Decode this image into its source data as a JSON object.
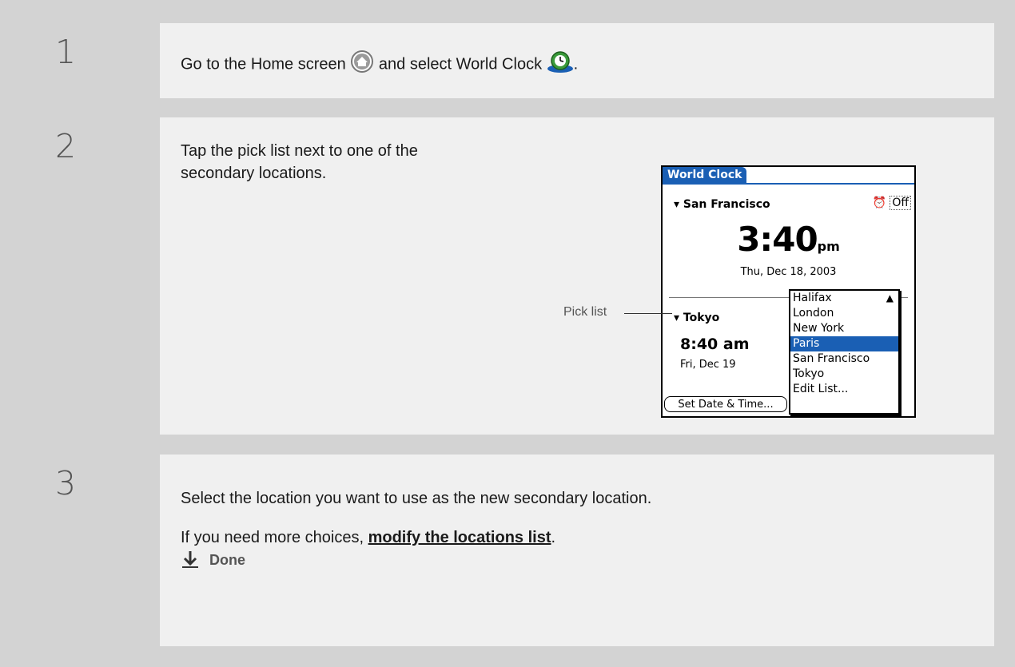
{
  "steps": [
    {
      "number": "1",
      "text_before_home": "Go to the Home screen",
      "text_before_worldclock": "and select World Clock",
      "text_end": "."
    },
    {
      "number": "2",
      "text_line1": "Tap the pick list next to one of the",
      "text_line2": "secondary locations."
    },
    {
      "number": "3",
      "text1": "Select the location you want to use as the new secondary location.",
      "text2_before": "If you need more choices,",
      "text2_link": "modify the locations list",
      "text2_after": ".",
      "done_label": "Done"
    }
  ],
  "callout": {
    "label": "Pick list"
  },
  "palm": {
    "title": "World Clock",
    "primary_location": "San Francisco",
    "alarm_state": "Off",
    "primary_time": "3:40",
    "primary_ampm": "pm",
    "primary_date": "Thu, Dec 18, 2003",
    "secondary_location": "Tokyo",
    "secondary_time": "8:40 am",
    "secondary_date": "Fri, Dec 19",
    "set_button": "Set Date & Time...",
    "picklist": [
      "Halifax",
      "London",
      "New York",
      "Paris",
      "San Francisco",
      "Tokyo",
      "Edit List..."
    ],
    "picklist_selected": "Paris"
  },
  "icons": {
    "home": "home-icon",
    "world_clock": "world-clock-icon",
    "done": "down-arrow-icon"
  },
  "colors": {
    "accent": "#1a5fb4",
    "background": "#d3d3d3",
    "panel": "#f0f0f0"
  }
}
